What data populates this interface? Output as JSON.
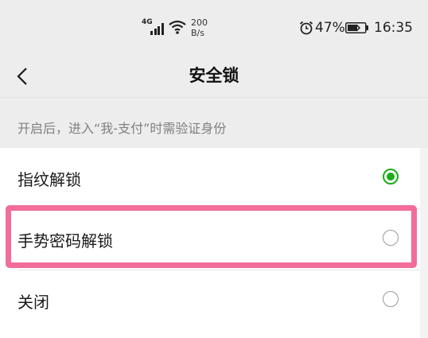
{
  "status_bar": {
    "network_type": "4G",
    "speed_value": "200",
    "speed_unit": "B/s",
    "battery_percent": "47%",
    "time": "16:35",
    "icons": [
      "signal-icon",
      "wifi-icon",
      "alarm-icon",
      "battery-icon"
    ]
  },
  "nav": {
    "back_icon": "chevron-left-icon",
    "title": "安全锁"
  },
  "hint": "开启后，进入“我-支付”时需验证身份",
  "options": [
    {
      "label": "指纹解锁",
      "checked": true
    },
    {
      "label": "手势密码解锁",
      "checked": false
    },
    {
      "label": "关闭",
      "checked": false
    }
  ],
  "colors": {
    "accent": "#1aad19",
    "highlight": "#f26d98",
    "background": "#ededed"
  }
}
